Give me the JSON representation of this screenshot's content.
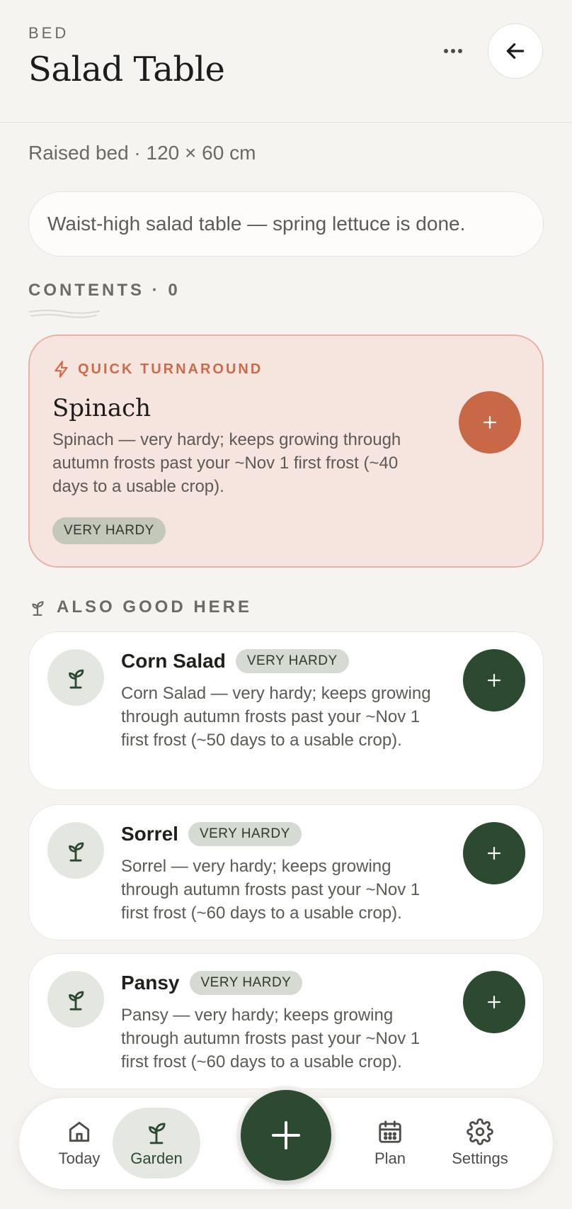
{
  "header": {
    "eyebrow": "BED",
    "title": "Salad Table",
    "more_label": "···"
  },
  "bed": {
    "dimensions": "Raised bed · 120 × 60 cm",
    "note": "Waist-high salad table — spring lettuce is done."
  },
  "contents": {
    "label": "CONTENTS · 0"
  },
  "feature": {
    "eyebrow": "QUICK TURNAROUND",
    "name": "Spinach",
    "description": "Spinach — very hardy; keeps growing through autumn frosts past your ~Nov 1 first frost (~40 days to a usable crop).",
    "tag": "VERY HARDY",
    "add_label": "+",
    "accent": "#c96847"
  },
  "also_good": {
    "label": "ALSO GOOD HERE",
    "items": [
      {
        "name": "Corn Salad",
        "tag": "VERY HARDY",
        "description": "Corn Salad — very hardy; keeps growing through autumn frosts past your ~Nov 1 first frost (~50 days to a usable crop).",
        "add_label": "+"
      },
      {
        "name": "Sorrel",
        "tag": "VERY HARDY",
        "description": "Sorrel — very hardy; keeps growing through autumn frosts past your ~Nov 1 first frost (~60 days to a usable crop).",
        "add_label": "+"
      },
      {
        "name": "Pansy",
        "tag": "VERY HARDY",
        "description": "Pansy — very hardy; keeps growing through autumn frosts past your ~Nov 1 first frost (~60 days to a usable crop).",
        "add_label": "+"
      }
    ]
  },
  "nav": {
    "items": [
      {
        "label": "Today",
        "icon": "home-icon"
      },
      {
        "label": "Garden",
        "icon": "sprout-icon",
        "active": true
      },
      {
        "label": "Plan",
        "icon": "calendar-icon"
      },
      {
        "label": "Settings",
        "icon": "gear-icon"
      }
    ],
    "fab_icon": "plus-icon"
  },
  "colors": {
    "primary": "#2c4a2f",
    "accent": "#c96847",
    "background": "#f6f4f0"
  }
}
